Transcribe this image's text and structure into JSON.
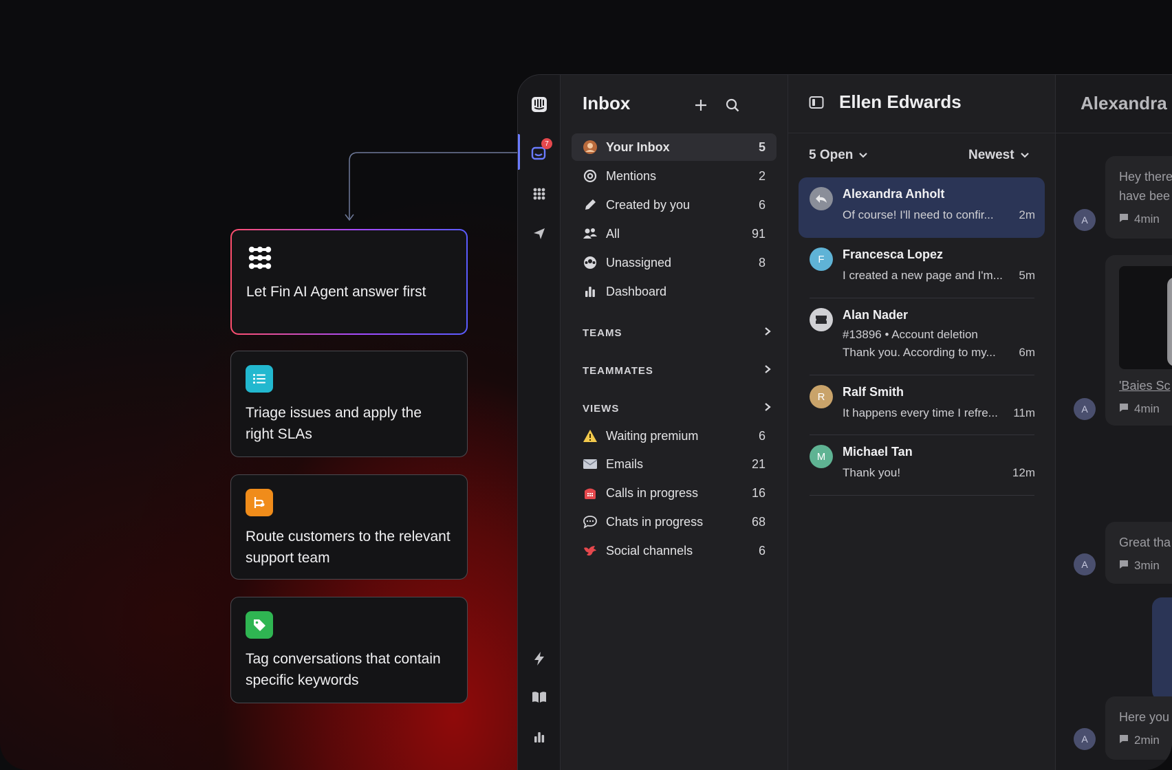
{
  "features": [
    {
      "label": "Let Fin AI Agent answer first",
      "icon": "fin-icon",
      "color": "#ffffff"
    },
    {
      "label": "Triage issues and apply the right SLAs",
      "icon": "list-icon",
      "color": "#22b8cf"
    },
    {
      "label": "Route customers to the relevant support team",
      "icon": "route-icon",
      "color": "#f08c1a"
    },
    {
      "label": "Tag conversations that contain specific keywords",
      "icon": "tag-icon",
      "color": "#2fb552"
    }
  ],
  "rail": {
    "notification_count": "7",
    "icons": [
      "logo-icon",
      "inbox-icon",
      "apps-icon",
      "send-icon",
      "bolt-icon",
      "book-icon",
      "reports-icon"
    ]
  },
  "inbox": {
    "title": "Inbox",
    "items": [
      {
        "label": "Your Inbox",
        "count": "5",
        "icon": "avatar-icon"
      },
      {
        "label": "Mentions",
        "count": "2",
        "icon": "at-icon"
      },
      {
        "label": "Created by you",
        "count": "6",
        "icon": "pencil-icon"
      },
      {
        "label": "All",
        "count": "91",
        "icon": "people-icon"
      },
      {
        "label": "Unassigned",
        "count": "8",
        "icon": "unassigned-icon"
      },
      {
        "label": "Dashboard",
        "count": "",
        "icon": "bar-chart-icon"
      }
    ],
    "sections": [
      "TEAMS",
      "TEAMMATES",
      "VIEWS"
    ],
    "views": [
      {
        "label": "Waiting premium",
        "count": "6",
        "icon": "warning-icon"
      },
      {
        "label": "Emails",
        "count": "21",
        "icon": "envelope-icon"
      },
      {
        "label": "Calls in progress",
        "count": "16",
        "icon": "phone-icon"
      },
      {
        "label": "Chats in progress",
        "count": "68",
        "icon": "speech-icon"
      },
      {
        "label": "Social channels",
        "count": "6",
        "icon": "bird-icon"
      }
    ]
  },
  "conversations": {
    "title": "Ellen Edwards",
    "filter": "5 Open",
    "sort": "Newest",
    "items": [
      {
        "name": "Alexandra Anholt",
        "preview": "Of course! I'll need to confir...",
        "time": "2m",
        "avatar": "",
        "sub": ""
      },
      {
        "name": "Francesca Lopez",
        "preview": "I created a new page and I'm...",
        "time": "5m",
        "avatar": "F",
        "sub": ""
      },
      {
        "name": "Alan Nader",
        "preview": "Thank you. According to my...",
        "time": "6m",
        "avatar": "",
        "sub": "#13896 • Account deletion"
      },
      {
        "name": "Ralf Smith",
        "preview": "It happens every time I refre...",
        "time": "11m",
        "avatar": "R",
        "sub": ""
      },
      {
        "name": "Michael Tan",
        "preview": "Thank you!",
        "time": "12m",
        "avatar": "M",
        "sub": ""
      }
    ]
  },
  "chat": {
    "title": "Alexandra",
    "messages": [
      {
        "text1": "Hey there",
        "text2": "have bee",
        "time": "4min"
      },
      {
        "text1": "'Baies Sc",
        "text2": "",
        "time": "4min"
      },
      {
        "text1": "Great tha",
        "text2": "",
        "time": "3min"
      },
      {
        "text1": "Here you",
        "text2": "",
        "time": "2min"
      }
    ],
    "avatar_letter": "A"
  }
}
